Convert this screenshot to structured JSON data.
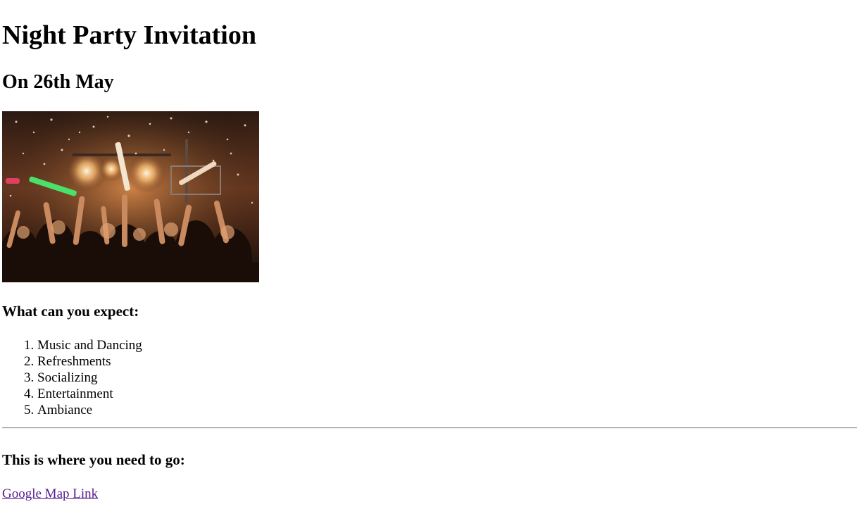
{
  "page": {
    "title": "Night Party Invitation",
    "date": "On 26th May",
    "photo_label": "party-crowd-photo"
  },
  "expect": {
    "heading": "What can you expect:",
    "items": [
      "Music and Dancing",
      "Refreshments",
      "Socializing",
      "Entertainment",
      "Ambiance"
    ]
  },
  "directions": {
    "heading": "This is where you need to go:",
    "link_text": "Google Map Link"
  },
  "colors": {
    "visited_link": "#551a8b",
    "divider": "#9a9a9a"
  }
}
